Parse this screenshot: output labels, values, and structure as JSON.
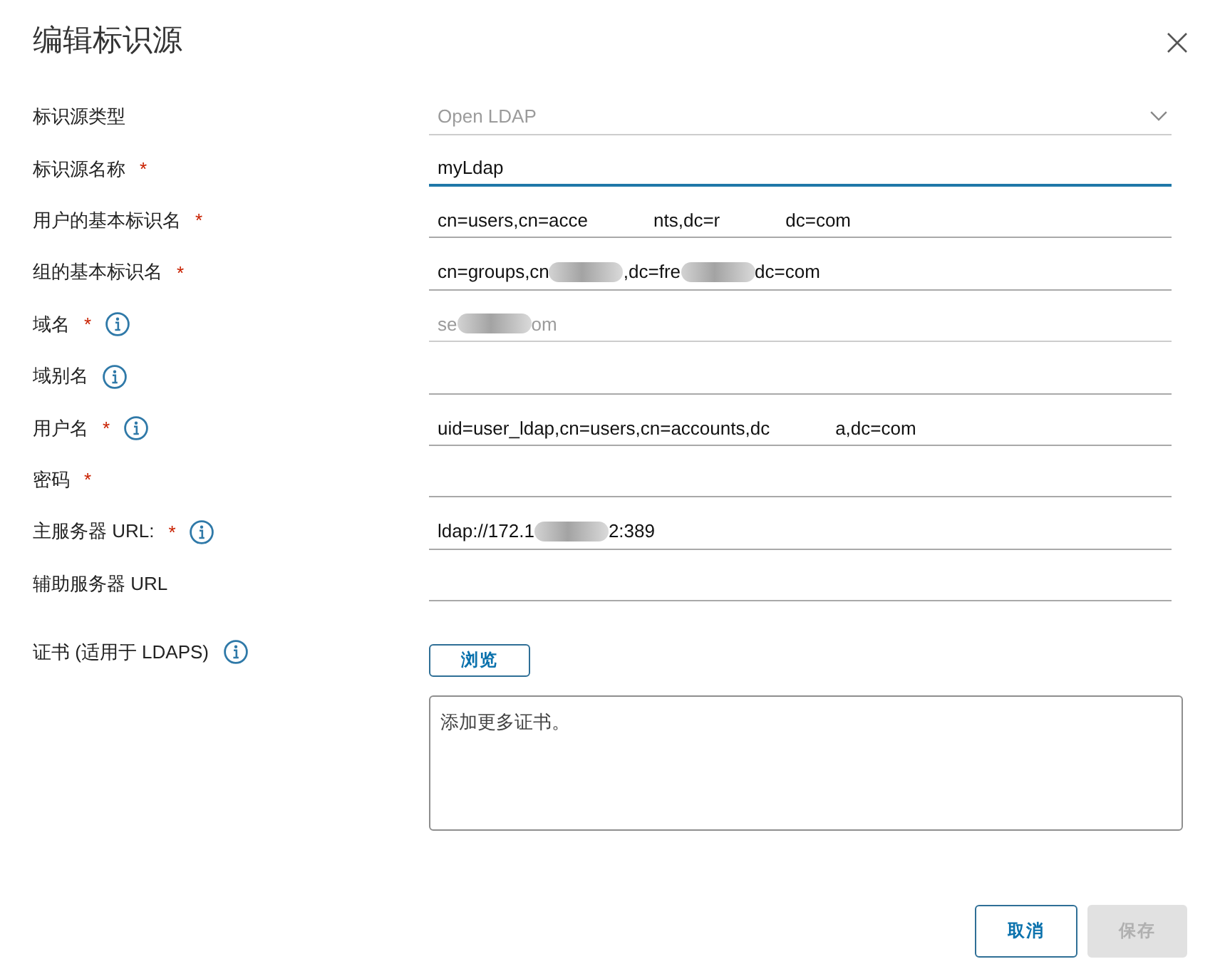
{
  "dialog": {
    "title": "编辑标识源"
  },
  "fields": [
    {
      "label": "标识源类型",
      "info": false,
      "kind": "select",
      "value": "Open LDAP",
      "disabled": true,
      "focused": false
    },
    {
      "label": "标识源名称",
      "required_mark": "*",
      "info": false,
      "kind": "text",
      "value_parts": [
        {
          "kind": "text",
          "text": "myLdap"
        }
      ],
      "disabled": false,
      "focused": true
    },
    {
      "label": "用户的基本标识名",
      "required_mark": "*",
      "info": false,
      "kind": "text",
      "value_parts": [
        {
          "kind": "text",
          "text": "cn=users,cn=acce"
        },
        {
          "kind": "gap"
        },
        {
          "kind": "text",
          "text": "nts,dc=r"
        },
        {
          "kind": "gap"
        },
        {
          "kind": "text",
          "text": "dc=com"
        }
      ],
      "disabled": false,
      "focused": false
    },
    {
      "label": "组的基本标识名",
      "required_mark": "*",
      "info": false,
      "kind": "text",
      "value_parts": [
        {
          "kind": "text",
          "text": "cn=groups,cn"
        },
        {
          "kind": "smear"
        },
        {
          "kind": "text",
          "text": ",dc=fre"
        },
        {
          "kind": "smear"
        },
        {
          "kind": "text",
          "text": "dc=com"
        }
      ],
      "disabled": false,
      "focused": false
    },
    {
      "label": "域名",
      "required_mark": "*",
      "info": true,
      "kind": "text",
      "value_parts": [
        {
          "kind": "text",
          "text": "se"
        },
        {
          "kind": "smear"
        },
        {
          "kind": "text",
          "text": "om"
        }
      ],
      "disabled": true,
      "focused": false
    },
    {
      "label": "域别名",
      "info": true,
      "kind": "text",
      "disabled": false,
      "focused": false
    },
    {
      "label": "用户名",
      "required_mark": "*",
      "info": true,
      "kind": "text",
      "value_parts": [
        {
          "kind": "text",
          "text": "uid=user_ldap,cn=users,cn=accounts,dc"
        },
        {
          "kind": "gap"
        },
        {
          "kind": "text",
          "text": "a,dc=com"
        }
      ],
      "disabled": false,
      "focused": false
    },
    {
      "label": "密码",
      "required_mark": "*",
      "info": false,
      "kind": "password",
      "disabled": false,
      "focused": false
    },
    {
      "label": "主服务器 URL:",
      "required_mark": "*",
      "info": true,
      "kind": "text",
      "value_parts": [
        {
          "kind": "text",
          "text": "ldap://172.1"
        },
        {
          "kind": "smear"
        },
        {
          "kind": "text",
          "text": "2:389"
        }
      ],
      "disabled": false,
      "focused": false
    },
    {
      "label": "辅助服务器 URL",
      "info": false,
      "kind": "text",
      "disabled": false,
      "focused": false
    }
  ],
  "certificate": {
    "label": "证书 (适用于 LDAPS)",
    "info": true,
    "browse_button": "浏览",
    "placeholder": "添加更多证书。"
  },
  "buttons": [
    {
      "label": "取消",
      "disabled": false
    },
    {
      "label": "保存",
      "disabled": true
    }
  ]
}
